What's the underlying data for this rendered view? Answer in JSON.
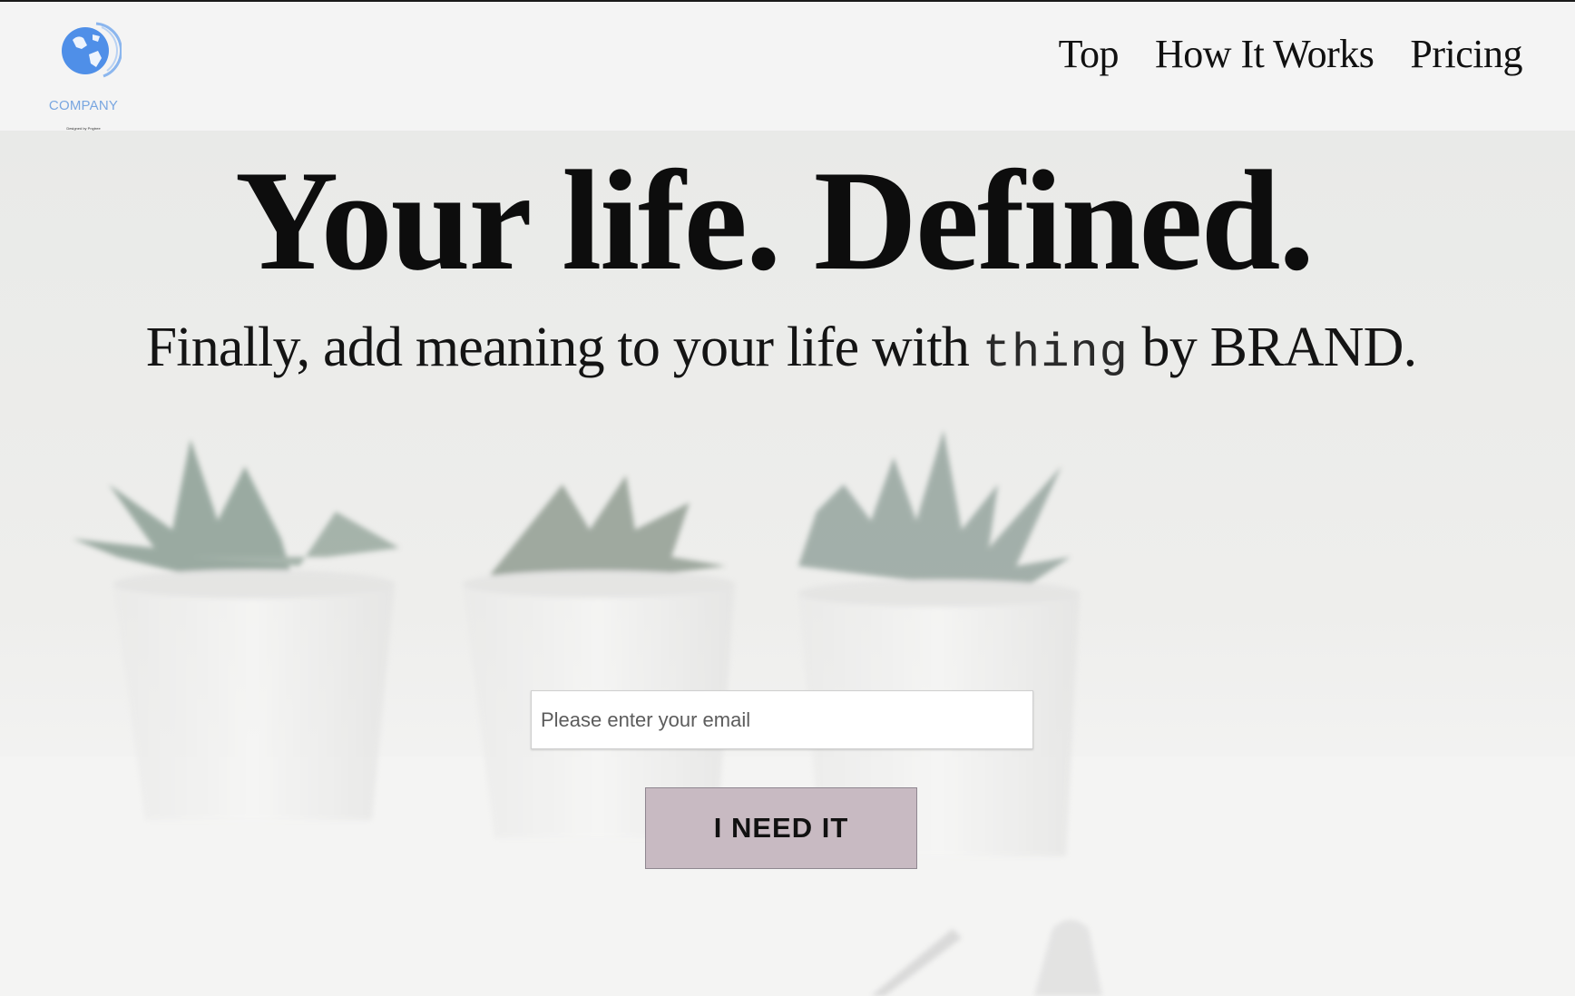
{
  "brand": {
    "logo_text": "COMPANY",
    "logo_tagline": "Designed by Pngtree",
    "accent_color": "#79a6e0"
  },
  "nav": {
    "items": [
      {
        "label": "Top"
      },
      {
        "label": "How It Works"
      },
      {
        "label": "Pricing"
      }
    ]
  },
  "hero": {
    "title": "Your life. Defined.",
    "subtitle_pre": "Finally, add meaning to your life with",
    "subtitle_product": "thing",
    "subtitle_post": "by BRAND."
  },
  "signup": {
    "email_placeholder": "Please enter your email",
    "email_value": "",
    "button_label": "I NEED IT",
    "button_color": "#c8bac2"
  }
}
